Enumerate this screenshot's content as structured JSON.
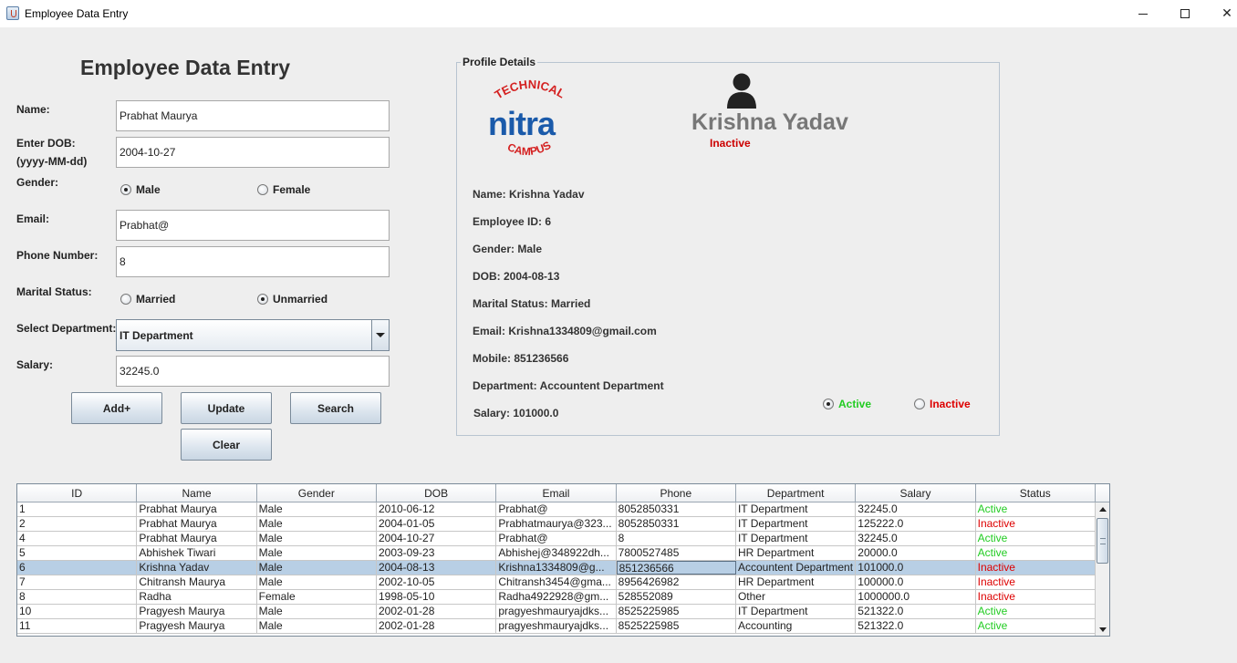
{
  "window": {
    "title": "Employee Data Entry",
    "minimize": "–",
    "maximize": "☐",
    "close": "✕"
  },
  "form": {
    "title": "Employee Data Entry",
    "name_label": "Name:",
    "name_value": "Prabhat Maurya",
    "dob_label_1": "Enter DOB:",
    "dob_label_2": "(yyyy-MM-dd)",
    "dob_value": "2004-10-27",
    "gender_label": "Gender:",
    "gender_male": "Male",
    "gender_female": "Female",
    "gender_selected": "Male",
    "email_label": "Email:",
    "email_value": "Prabhat@",
    "phone_label": "Phone Number:",
    "phone_value": "8",
    "marital_label": "Marital Status:",
    "marital_married": "Married",
    "marital_unmarried": "Unmarried",
    "marital_selected": "Unmarried",
    "department_label": "Select Department:",
    "department_value": "IT Department",
    "salary_label": "Salary:",
    "salary_value": "32245.0",
    "buttons": {
      "add": "Add+",
      "update": "Update",
      "search": "Search",
      "clear": "Clear"
    }
  },
  "profile": {
    "legend": "Profile Details",
    "logo_text": {
      "top": "TECHNICAL",
      "middle": "nitra",
      "bottom": "CAMPUS"
    },
    "name_big": "Krishna Yadav",
    "status_big": "Inactive",
    "name": "Name: Krishna Yadav",
    "employee_id": "Employee ID: 6",
    "gender": "Gender: Male",
    "dob": "DOB: 2004-08-13",
    "marital": "Marital Status: Married",
    "email": "Email: Krishna1334809@gmail.com",
    "mobile": "Mobile: 851236566",
    "department": "Department: Accountent Department",
    "salary": "Salary: 101000.0",
    "active_label": "Active",
    "inactive_label": "Inactive",
    "status_selected": "Active",
    "colors": {
      "active": "#22cc22",
      "inactive": "#dd0000",
      "name_big": "#777777"
    }
  },
  "table": {
    "columns": [
      "ID",
      "Name",
      "Gender",
      "DOB",
      "Email",
      "Phone",
      "Department",
      "Salary",
      "Status"
    ],
    "rows": [
      [
        "1",
        "Prabhat Maurya",
        "Male",
        "2010-06-12",
        "Prabhat@",
        "8052850331",
        "IT Department",
        "32245.0",
        "Active"
      ],
      [
        "2",
        "Prabhat Maurya",
        "Male",
        "2004-01-05",
        "Prabhatmaurya@323...",
        "8052850331",
        "IT Department",
        "125222.0",
        "Inactive"
      ],
      [
        "4",
        "Prabhat Maurya",
        "Male",
        "2004-10-27",
        "Prabhat@",
        "8",
        "IT Department",
        "32245.0",
        "Active"
      ],
      [
        "5",
        "Abhishek Tiwari",
        "Male",
        "2003-09-23",
        "Abhishej@348922dh...",
        "7800527485",
        "HR Department",
        "20000.0",
        "Active"
      ],
      [
        "6",
        "Krishna Yadav",
        "Male",
        "2004-08-13",
        "Krishna1334809@g...",
        "851236566",
        "Accountent Department",
        "101000.0",
        "Inactive"
      ],
      [
        "7",
        "Chitransh Maurya",
        "Male",
        "2002-10-05",
        "Chitransh3454@gma...",
        "8956426982",
        "HR Department",
        "100000.0",
        "Inactive"
      ],
      [
        "8",
        "Radha",
        "Female",
        "1998-05-10",
        "Radha4922928@gm...",
        "528552089",
        "Other",
        "1000000.0",
        "Inactive"
      ],
      [
        "10",
        "Pragyesh Maurya",
        "Male",
        "2002-01-28",
        "pragyeshmauryajdks...",
        "8525225985",
        "IT Department",
        "521322.0",
        "Active"
      ],
      [
        "11",
        "Pragyesh Maurya",
        "Male",
        "2002-01-28",
        "pragyeshmauryajdks...",
        "8525225985",
        "Accounting",
        "521322.0",
        "Active"
      ]
    ],
    "selected_row_index": 4
  }
}
